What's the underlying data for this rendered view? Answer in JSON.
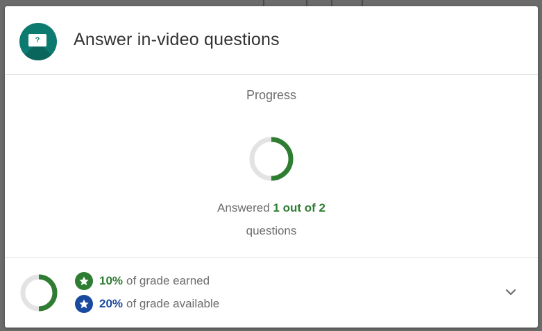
{
  "header": {
    "icon": "question-screen-icon",
    "icon_glyph": "?",
    "title": "Answer in-video questions",
    "accent_color": "#0d7a70"
  },
  "progress": {
    "label": "Progress",
    "answered_prefix": "Answered",
    "answered_count": "1 out of 2",
    "answered_suffix": "questions",
    "answered_value": 1,
    "total_value": 2,
    "ring_color": "#2e7d32",
    "track_color": "#e3e3e3"
  },
  "grade": {
    "earned_pct": "10%",
    "earned_text": "of grade earned",
    "earned_color": "#2e7d32",
    "available_pct": "20%",
    "available_text": "of grade available",
    "available_color": "#1a4aa0",
    "earned_fraction": 0.5,
    "expand_icon": "chevron-down-icon"
  }
}
